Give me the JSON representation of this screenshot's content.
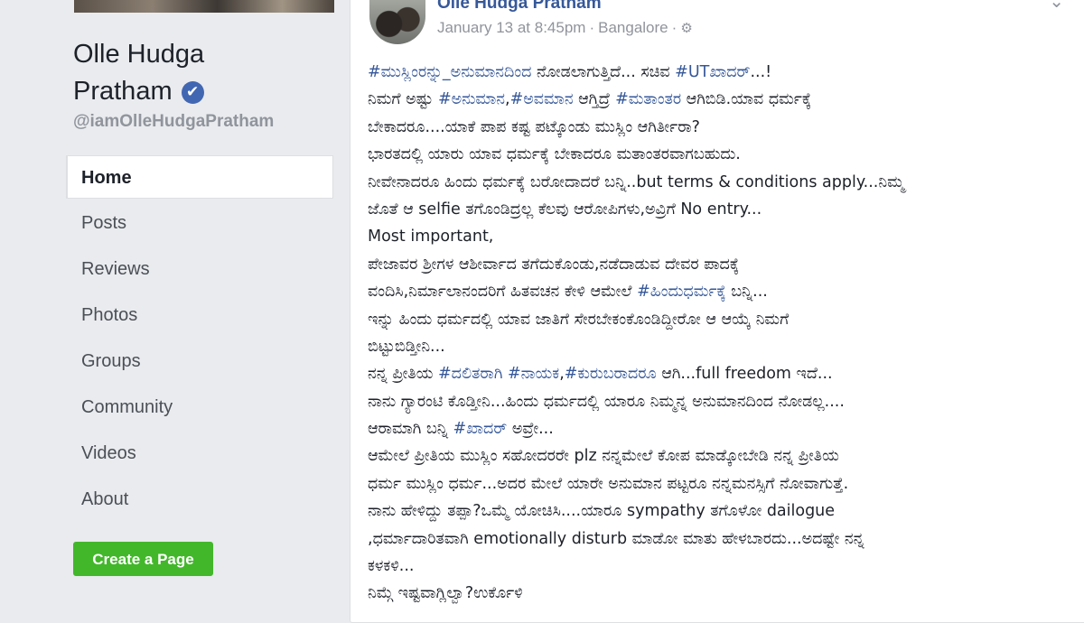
{
  "sidebar": {
    "page_name_line1": "Olle Hudga",
    "page_name_line2": "Pratham",
    "verified_glyph": "✔",
    "handle": "@iamOlleHudgaPratham",
    "nav_items": [
      {
        "label": "Home",
        "active": true
      },
      {
        "label": "Posts"
      },
      {
        "label": "Reviews"
      },
      {
        "label": "Photos"
      },
      {
        "label": "Groups"
      },
      {
        "label": "Community"
      },
      {
        "label": "Videos"
      },
      {
        "label": "About"
      }
    ],
    "create_page_label": "Create a Page"
  },
  "post": {
    "author": "Olle Hudga Pratham",
    "timestamp": "January 13 at 8:45pm",
    "separator": "·",
    "location": "Bangalore",
    "privacy_icon": "globe-icon",
    "lines": [
      [
        {
          "t": "#ಮುಸ್ಲಿಂರನ್ನು_ಅನುಮಾನದಿಂದ",
          "h": true
        },
        {
          "t": " ನೋಡಲಾಗುತ್ತಿದೆ... ಸಚಿವ "
        },
        {
          "t": "#UTಖಾದರ್",
          "h": true
        },
        {
          "t": "...!"
        }
      ],
      [
        {
          "t": "ನಿಮಗೆ ಅಷ್ಟು "
        },
        {
          "t": "#ಅನುಮಾನ",
          "h": true
        },
        {
          "t": ","
        },
        {
          "t": "#ಅವಮಾನ",
          "h": true
        },
        {
          "t": " ಆಗ್ತಿದ್ರೆ "
        },
        {
          "t": "#ಮತಾಂತರ",
          "h": true
        },
        {
          "t": " ಆಗಿಬಿಡಿ.ಯಾವ ಧರ್ಮಕ್ಕೆ"
        }
      ],
      [
        {
          "t": "ಬೇಕಾದರೂ....ಯಾಕೆ ಪಾಪ ಕಷ್ಟ ಪಟ್ಕೊಂಡು ಮುಸ್ಲಿಂ ಆಗಿರ್ತೀರಾ?"
        }
      ],
      [
        {
          "t": "ಭಾರತದಲ್ಲಿ ಯಾರು ಯಾವ ಧರ್ಮಕ್ಕೆ ಬೇಕಾದರೂ ಮತಾಂತರವಾಗಬಹುದು."
        }
      ],
      [
        {
          "t": "ನೀವೇನಾದರೂ ಹಿಂದು ಧರ್ಮಕ್ಕೆ ಬರೋದಾದರೆ ಬನ್ನಿ..but terms & conditions apply...ನಿಮ್ಮ"
        }
      ],
      [
        {
          "t": "ಜೊತೆ ಆ selfie ತಗೊಂಡಿದ್ರಲ್ಲ ಕೆಲವು ಆರೋಪಿಗಳು,ಅವ್ರಿಗೆ No entry..."
        }
      ],
      [
        {
          "t": "Most important,"
        }
      ],
      [
        {
          "t": "ಪೇಜಾವರ ಶ್ರೀಗಳ ಆಶೀರ್ವಾದ ತಗೆದುಕೊಂಡು,ನಡೆದಾಡುವ ದೇವರ ಪಾದಕ್ಕೆ"
        }
      ],
      [
        {
          "t": "ವಂದಿಸಿ,ನಿರ್ಮಾಲಾನಂದರಿಗೆ ಹಿತವಚನ ಕೇಳಿ ಆಮೇಲೆ "
        },
        {
          "t": "#ಹಿಂದುಧರ್ಮಕ್ಕೆ",
          "h": true
        },
        {
          "t": " ಬನ್ನಿ..."
        }
      ],
      [
        {
          "t": "ಇನ್ನು ಹಿಂದು ಧರ್ಮದಲ್ಲಿ ಯಾವ ಜಾತಿಗೆ ಸೇರಬೇಕಂಕೊಂಡಿದ್ದೀರೋ ಆ ಆಯ್ಕೆ ನಿಮಗೆ"
        }
      ],
      [
        {
          "t": "ಬಿಟ್ಟುಬಿಡ್ತೀನಿ..."
        }
      ],
      [
        {
          "t": "ನನ್ನ ಪ್ರೀತಿಯ "
        },
        {
          "t": "#ದಲಿತರಾಗಿ",
          "h": true
        },
        {
          "t": " "
        },
        {
          "t": "#ನಾಯಕ",
          "h": true
        },
        {
          "t": ","
        },
        {
          "t": "#ಕುರುಬರಾದರೂ",
          "h": true
        },
        {
          "t": " ಆಗಿ...full freedom ಇದೆ..."
        }
      ],
      [
        {
          "t": "ನಾನು ಗ್ಯಾರಂಟಿ ಕೊಡ್ತೀನಿ...ಹಿಂದು ಧರ್ಮದಲ್ಲಿ ಯಾರೂ ನಿಮ್ಮನ್ನ ಅನುಮಾನದಿಂದ ನೋಡಲ್ಲ...."
        }
      ],
      [
        {
          "t": "ಆರಾಮಾಗಿ ಬನ್ನಿ "
        },
        {
          "t": "#ಖಾದರ್",
          "h": true
        },
        {
          "t": " ಅವ್ರೇ..."
        }
      ],
      [
        {
          "t": "ಆಮೇಲೆ ಪ್ರೀತಿಯ ಮುಸ್ಲಿಂ ಸಹೋದರರೇ plz ನನ್ನಮೇಲೆ ಕೋಪ ಮಾಡ್ಕೋಬೇಡಿ ನನ್ನ ಪ್ರೀತಿಯ"
        }
      ],
      [
        {
          "t": "ಧರ್ಮ ಮುಸ್ಲಿಂ ಧರ್ಮ...ಅದರ ಮೇಲೆ ಯಾರೇ ಅನುಮಾನ ಪಟ್ಟರೂ ನನ್ನಮನಸ್ಸಿಗೆ ನೋವಾಗುತ್ತೆ."
        }
      ],
      [
        {
          "t": "ನಾನು ಹೇಳಿದ್ದು ತಪ್ಪಾ?ಒಮ್ಮೆ ಯೋಚಿಸಿ....ಯಾರೂ sympathy ತಗೊಳೋ dailogue"
        }
      ],
      [
        {
          "t": ",ಧರ್ಮಾದಾರಿತವಾಗಿ emotionally disturb ಮಾಡೋ ಮಾತು ಹೇಳಬಾರದು...ಅದಷ್ಟೇ ನನ್ನ"
        }
      ],
      [
        {
          "t": "ಕಳಕಳಿ..."
        }
      ],
      [
        {
          "t": "ನಿಮ್ಗೆ ಇಷ್ಟವಾಗ್ಲಿಲ್ವಾ?ಉರ್ಕೊಳಿ"
        }
      ]
    ]
  },
  "colors": {
    "background": "#e9ebee",
    "link_blue": "#365899",
    "muted_text": "#90949c",
    "create_button_green": "#42b72a",
    "verified_blue": "#4267b2"
  }
}
